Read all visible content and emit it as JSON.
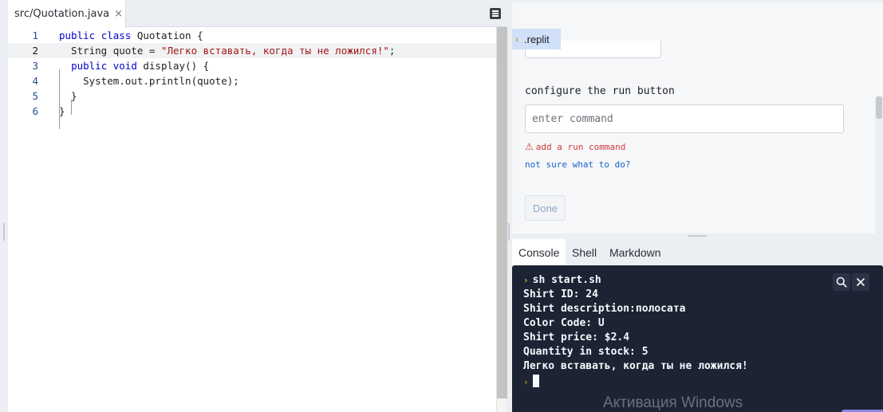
{
  "editor": {
    "tab": {
      "label": "src/Quotation.java",
      "close": "×"
    },
    "lines": [
      {
        "num": "1",
        "parts": [
          {
            "t": "kw",
            "v": "public"
          },
          {
            "t": "p",
            "v": " "
          },
          {
            "t": "kw",
            "v": "class"
          },
          {
            "t": "p",
            "v": " Quotation {"
          }
        ]
      },
      {
        "num": "2",
        "parts": [
          {
            "t": "p",
            "v": "  String quote = "
          },
          {
            "t": "str",
            "v": "\"Легко вставать, когда ты не ложился!\""
          },
          {
            "t": "p",
            "v": ";"
          }
        ]
      },
      {
        "num": "3",
        "parts": [
          {
            "t": "p",
            "v": "  "
          },
          {
            "t": "kw",
            "v": "public"
          },
          {
            "t": "p",
            "v": " "
          },
          {
            "t": "kw",
            "v": "void"
          },
          {
            "t": "p",
            "v": " display() {"
          }
        ]
      },
      {
        "num": "4",
        "parts": [
          {
            "t": "p",
            "v": "    System.out.println(quote);"
          }
        ]
      },
      {
        "num": "5",
        "parts": [
          {
            "t": "p",
            "v": "  }"
          }
        ]
      },
      {
        "num": "6",
        "parts": [
          {
            "t": "p",
            "v": "}"
          }
        ]
      }
    ],
    "active_line": 2
  },
  "config": {
    "file_tab": ".replit",
    "run_label": "configure the run button",
    "command_placeholder": "enter command",
    "error_text": "add a run command",
    "help_link": "not sure what to do?",
    "done_label": "Done"
  },
  "console_tabs": [
    "Console",
    "Shell",
    "Markdown"
  ],
  "console": {
    "command": "sh start.sh",
    "output": [
      "Shirt ID: 24",
      "Shirt description:полосата",
      "Color Code: U",
      "Shirt price: $2.4",
      "Quantity in stock: 5",
      "Легко вставать, когда ты не ложился!"
    ]
  },
  "watermark": "Активация Windows",
  "colors": {
    "console_bg": "#1c2333",
    "prompt": "#e8b339",
    "keyword": "#0000cc",
    "string": "#a31515",
    "error": "#d03a3a",
    "link": "#1a62c9"
  }
}
